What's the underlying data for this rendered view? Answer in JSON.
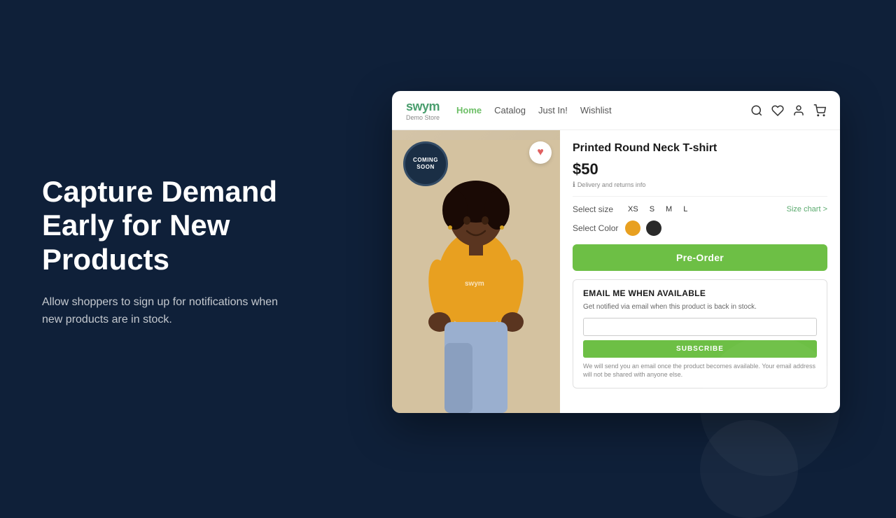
{
  "background": "#0f2039",
  "left": {
    "headline": "Capture Demand Early for New Products",
    "subtext": "Allow shoppers to sign up for notifications when new products are in stock."
  },
  "store": {
    "logo": {
      "name": "swym",
      "sub": "Demo Store"
    },
    "nav": {
      "links": [
        {
          "label": "Home",
          "active": true
        },
        {
          "label": "Catalog",
          "active": false
        },
        {
          "label": "Just In!",
          "active": false
        },
        {
          "label": "Wishlist",
          "active": false
        }
      ]
    },
    "product": {
      "title": "Printed Round Neck T-shirt",
      "price": "$50",
      "delivery_label": "Delivery and returns info",
      "coming_soon_line1": "COMING",
      "coming_soon_line2": "SOON",
      "size_label": "Select size",
      "sizes": [
        "XS",
        "S",
        "M",
        "L"
      ],
      "size_chart": "Size chart >",
      "color_label": "Select Color",
      "preorder_btn": "Pre-Order",
      "email_section": {
        "title": "EMAIL ME WHEN AVAILABLE",
        "description": "Get notified via email when this product is back in stock.",
        "input_placeholder": "",
        "subscribe_btn": "SUBSCRIBE",
        "privacy": "We will send you an email once the product becomes available. Your email address will not be shared with anyone else."
      }
    }
  }
}
